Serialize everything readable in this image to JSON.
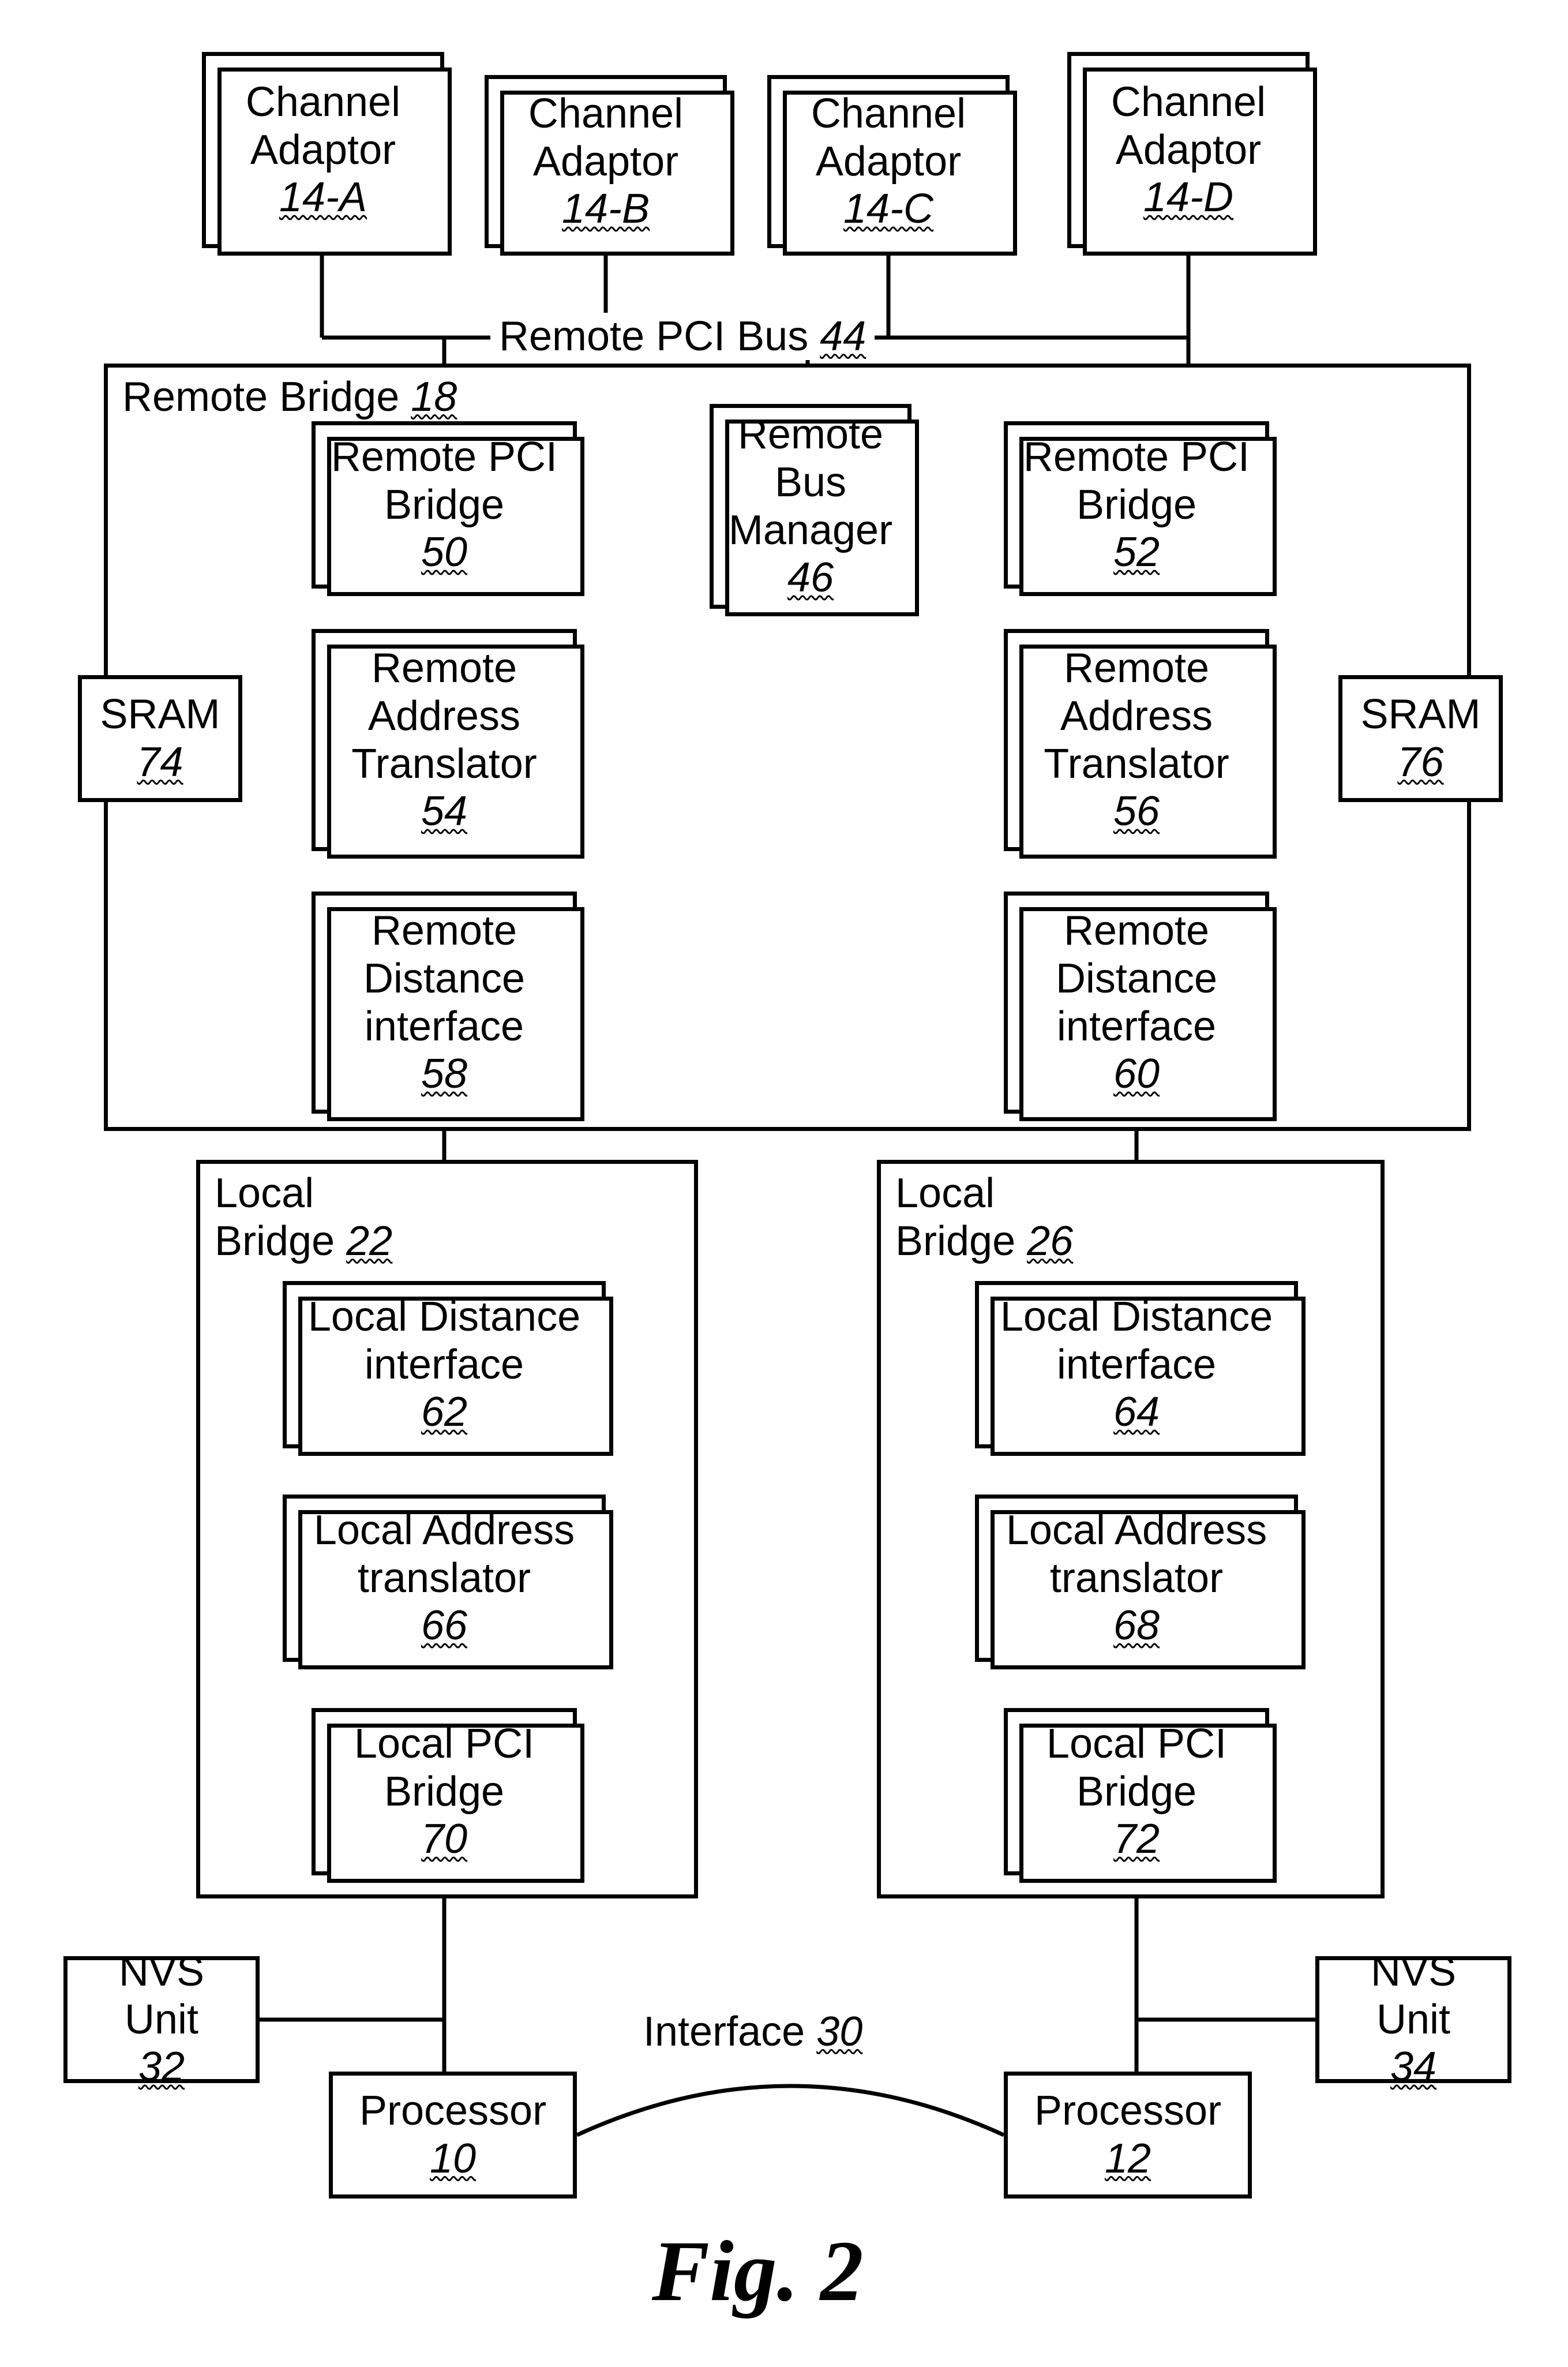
{
  "figure_label": "Fig. 2",
  "channel_adaptors": [
    {
      "label": "Channel Adaptor",
      "ref": "14-A"
    },
    {
      "label": "Channel Adaptor",
      "ref": "14-B"
    },
    {
      "label": "Channel Adaptor",
      "ref": "14-C"
    },
    {
      "label": "Channel Adaptor",
      "ref": "14-D"
    }
  ],
  "remote_pci_bus": {
    "label": "Remote PCI Bus",
    "ref": "44"
  },
  "remote_bridge": {
    "label": "Remote Bridge",
    "ref": "18"
  },
  "remote_pci_bridge_left": {
    "label": "Remote PCI Bridge",
    "ref": "50"
  },
  "remote_pci_bridge_right": {
    "label": "Remote PCI Bridge",
    "ref": "52"
  },
  "remote_bus_manager": {
    "label": "Remote Bus Manager",
    "ref": "46"
  },
  "remote_addr_trans_left": {
    "label": "Remote Address Translator",
    "ref": "54"
  },
  "remote_addr_trans_right": {
    "label": "Remote Address Translator",
    "ref": "56"
  },
  "sram_left": {
    "label": "SRAM",
    "ref": "74"
  },
  "sram_right": {
    "label": "SRAM",
    "ref": "76"
  },
  "remote_dist_left": {
    "label": "Remote Distance interface",
    "ref": "58"
  },
  "remote_dist_right": {
    "label": "Remote Distance interface",
    "ref": "60"
  },
  "local_bridge_left": {
    "label": "Local Bridge",
    "ref": "22"
  },
  "local_bridge_right": {
    "label": "Local Bridge",
    "ref": "26"
  },
  "local_dist_left": {
    "label": "Local Distance interface",
    "ref": "62"
  },
  "local_dist_right": {
    "label": "Local Distance interface",
    "ref": "64"
  },
  "local_addr_trans_left": {
    "label": "Local Address translator",
    "ref": "66"
  },
  "local_addr_trans_right": {
    "label": "Local Address translator",
    "ref": "68"
  },
  "local_pci_bridge_left": {
    "label": "Local PCI Bridge",
    "ref": "70"
  },
  "local_pci_bridge_right": {
    "label": "Local PCI Bridge",
    "ref": "72"
  },
  "nvs_left": {
    "label": "NVS Unit",
    "ref": "32"
  },
  "nvs_right": {
    "label": "NVS Unit",
    "ref": "34"
  },
  "processor_left": {
    "label": "Processor",
    "ref": "10"
  },
  "processor_right": {
    "label": "Processor",
    "ref": "12"
  },
  "interface": {
    "label": "Interface",
    "ref": "30"
  }
}
